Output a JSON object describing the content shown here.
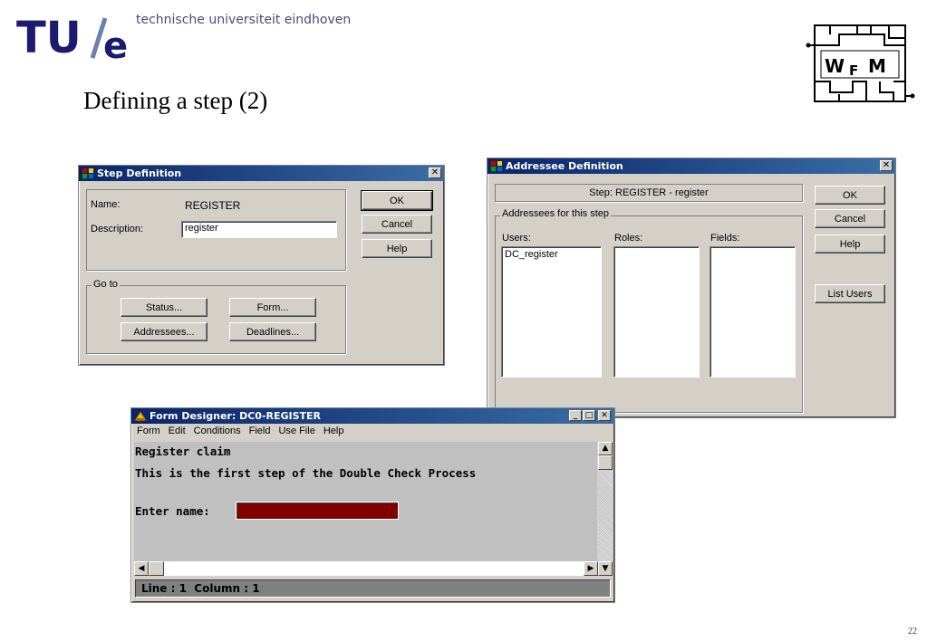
{
  "header": {
    "subtitle": "technische universiteit eindhoven",
    "slide_title": "Defining a step (2)",
    "page_number": "22"
  },
  "step_definition": {
    "title": "Step Definition",
    "name_label": "Name:",
    "name_value": "REGISTER",
    "description_label": "Description:",
    "description_value": "register",
    "ok_label": "OK",
    "cancel_label": "Cancel",
    "help_label": "Help",
    "goto_legend": "Go to",
    "status_label": "Status...",
    "form_label": "Form...",
    "addressees_label": "Addressees...",
    "deadlines_label": "Deadlines..."
  },
  "addressee_definition": {
    "title": "Addressee Definition",
    "step_text": "Step: REGISTER - register",
    "group_legend": "Addressees for this step",
    "users_label": "Users:",
    "roles_label": "Roles:",
    "fields_label": "Fields:",
    "users": [
      "DC_register"
    ],
    "ok_label": "OK",
    "cancel_label": "Cancel",
    "help_label": "Help",
    "list_users_label": "List Users"
  },
  "form_designer": {
    "title": "Form Designer: DC0-REGISTER",
    "menu": [
      "Form",
      "Edit",
      "Conditions",
      "Field",
      "Use File",
      "Help"
    ],
    "line1": "Register claim",
    "line2": "This is the first step of the Double Check Process",
    "field_label": "Enter name:",
    "status_text": "Line : 1  Column : 1",
    "input_color": "#800000"
  }
}
